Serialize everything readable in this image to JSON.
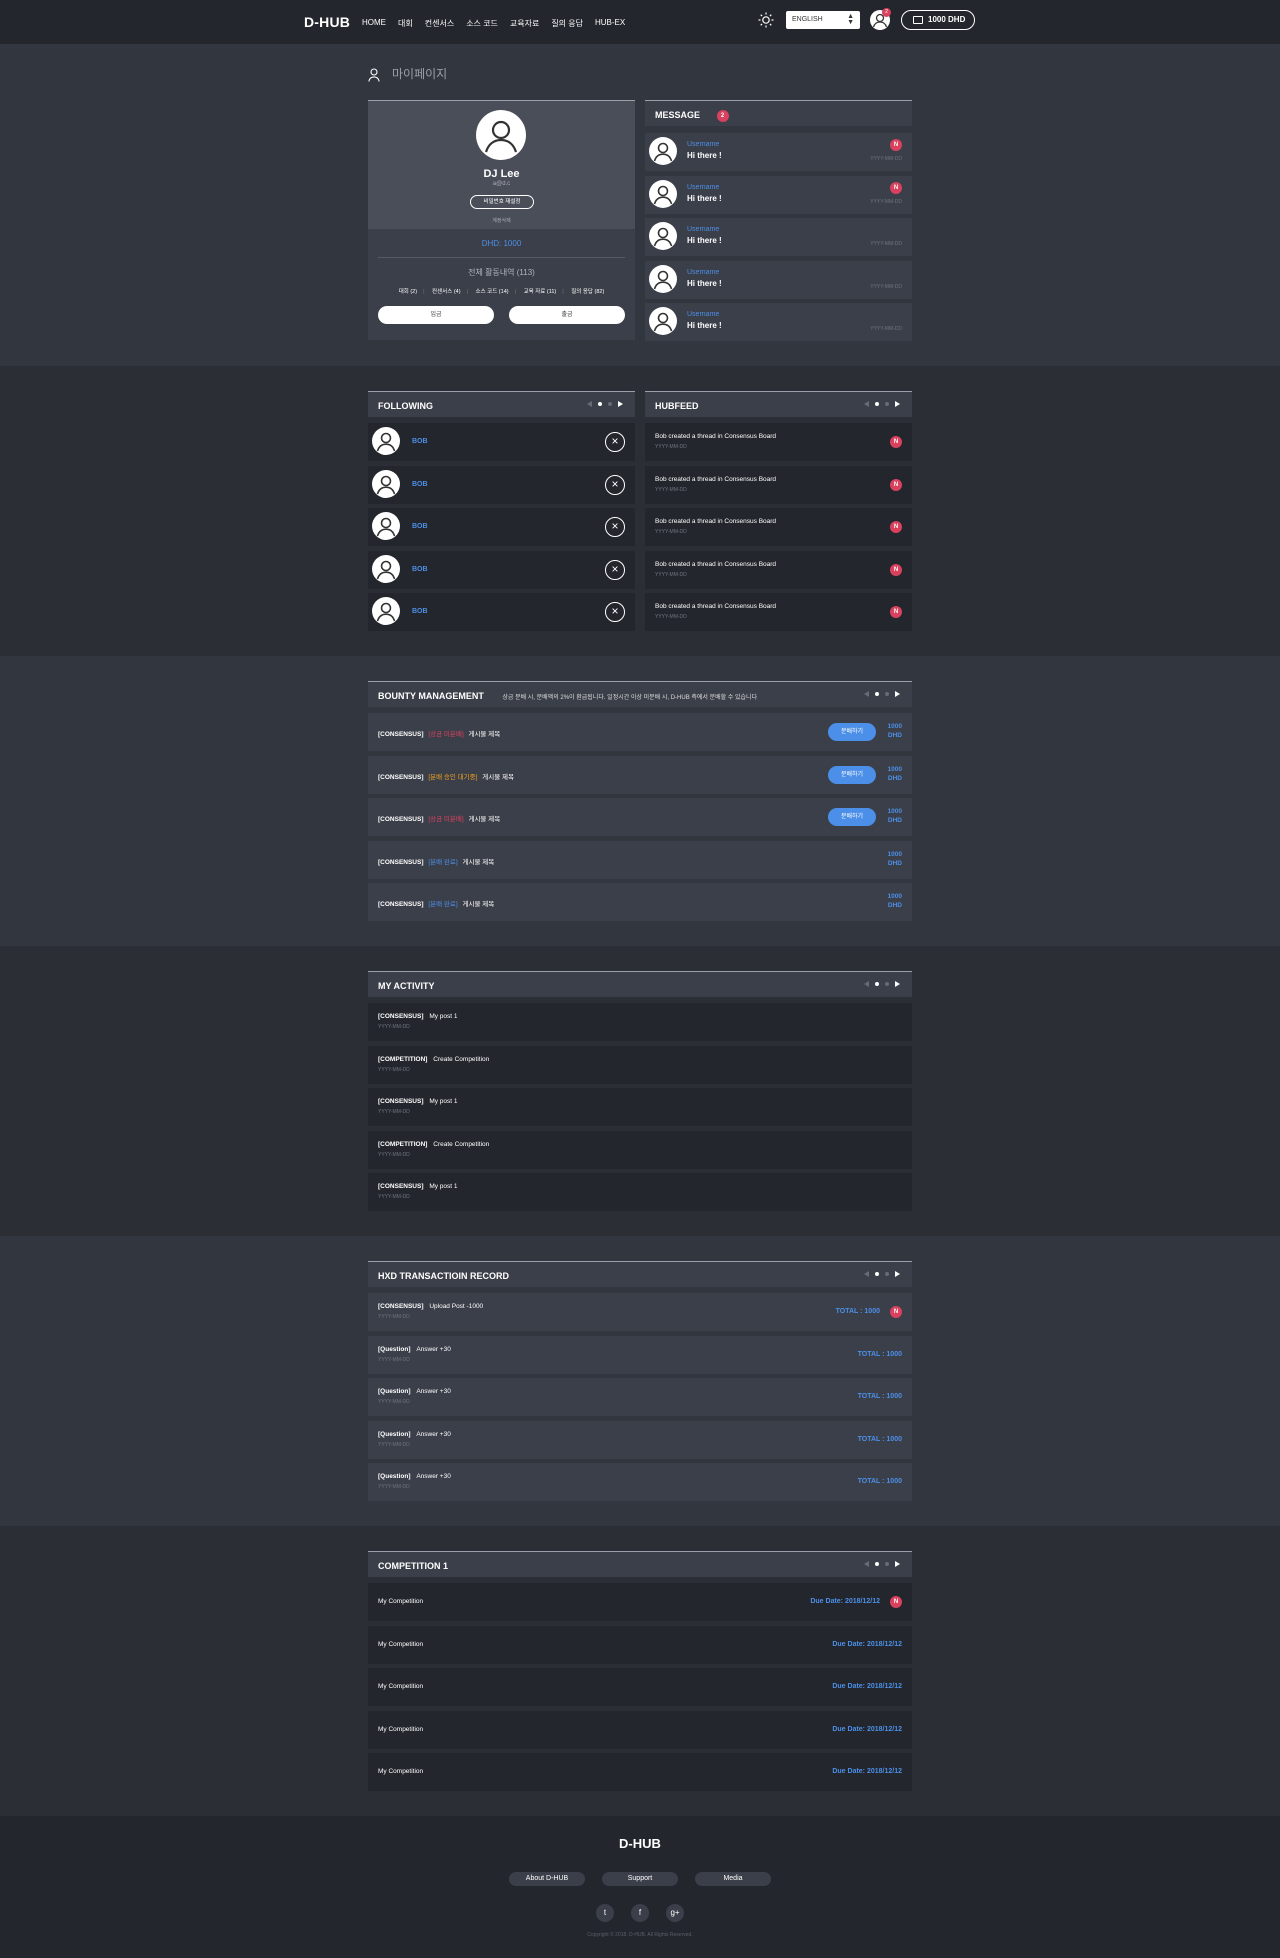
{
  "header": {
    "logo": "D-HUB",
    "nav": [
      "HOME",
      "대회",
      "컨센서스",
      "소스 코드",
      "교육자료",
      "질의 응답",
      "HUB-EX"
    ],
    "language": "ENGLISH",
    "notification_count": "2",
    "wallet": "1000 DHD"
  },
  "page_title": "마이페이지",
  "profile": {
    "name": "DJ Lee",
    "id": "a@d.c",
    "reset_password": "비밀번호 재설정",
    "delete_account": "계정삭제",
    "dhd": "DHD: 1000",
    "activity_total": "전체 활동내역 (113)",
    "categories": [
      "대회 (2)",
      "컨센서스 (4)",
      "소스 코드 (14)",
      "교육 자료 (11)",
      "질의 응답 (82)"
    ],
    "deposit": "입금",
    "withdraw": "출금"
  },
  "message": {
    "title": "MESSAGE",
    "count": "2",
    "items": [
      {
        "user": "Username",
        "text": "Hi there !",
        "date": "YYYY-MM-DD",
        "new": "N"
      },
      {
        "user": "Username",
        "text": "Hi there !",
        "date": "YYYY-MM-DD",
        "new": "N"
      },
      {
        "user": "Username",
        "text": "Hi there !",
        "date": "YYYY-MM-DD",
        "new": ""
      },
      {
        "user": "Username",
        "text": "Hi there !",
        "date": "YYYY-MM-DD",
        "new": ""
      },
      {
        "user": "Username",
        "text": "Hi there !",
        "date": "YYYY-MM-DD",
        "new": ""
      }
    ]
  },
  "following": {
    "title": "FOLLOWING",
    "items": [
      "BOB",
      "BOB",
      "BOB",
      "BOB",
      "BOB"
    ]
  },
  "hubfeed": {
    "title": "HUBFEED",
    "items": [
      {
        "text": "Bob created a thread in Consensus Board",
        "date": "YYYY-MM-DD",
        "new": "N"
      },
      {
        "text": "Bob created a thread in Consensus Board",
        "date": "YYYY-MM-DD",
        "new": "N"
      },
      {
        "text": "Bob created a thread in Consensus Board",
        "date": "YYYY-MM-DD",
        "new": "N"
      },
      {
        "text": "Bob created a thread in Consensus Board",
        "date": "YYYY-MM-DD",
        "new": "N"
      },
      {
        "text": "Bob created a thread in Consensus Board",
        "date": "YYYY-MM-DD",
        "new": "N"
      }
    ]
  },
  "bounty": {
    "title": "BOUNTY MANAGEMENT",
    "notice": "상금 분배 시, 분배액의 2%이 환급됩니다. 일정시간 이상 미분배 시, D-HUB 측에서 분배할 수 있습니다",
    "sell": "분배하기",
    "amount1": "1000",
    "amount2": "DHD",
    "items": [
      {
        "cat": "[CONSENSUS]",
        "status": "[상금 미분배]",
        "color": "#d9415e",
        "title": "게시물 제목",
        "btn": true
      },
      {
        "cat": "[CONSENSUS]",
        "status": "[분배 승인 대기중]",
        "color": "#f0a020",
        "title": "게시물 제목",
        "btn": true
      },
      {
        "cat": "[CONSENSUS]",
        "status": "[상금 미분배]",
        "color": "#d9415e",
        "title": "게시물 제목",
        "btn": true
      },
      {
        "cat": "[CONSENSUS]",
        "status": "[분배 완료]",
        "color": "#4c8fe8",
        "title": "게시물 제목",
        "btn": false
      },
      {
        "cat": "[CONSENSUS]",
        "status": "[분배 완료]",
        "color": "#4c8fe8",
        "title": "게시물 제목",
        "btn": false
      }
    ]
  },
  "activity": {
    "title": "MY ACTIVITY",
    "items": [
      {
        "cat": "[CONSENSUS]",
        "text": "My post 1",
        "date": "YYYY-MM-DD"
      },
      {
        "cat": "[COMPETITION]",
        "text": "Create Competition",
        "date": "YYYY-MM-DD"
      },
      {
        "cat": "[CONSENSUS]",
        "text": "My post 1",
        "date": "YYYY-MM-DD"
      },
      {
        "cat": "[COMPETITION]",
        "text": "Create Competition",
        "date": "YYYY-MM-DD"
      },
      {
        "cat": "[CONSENSUS]",
        "text": "My post 1",
        "date": "YYYY-MM-DD"
      }
    ]
  },
  "transactions": {
    "title": "HXD TRANSACTIOIN RECORD",
    "items": [
      {
        "cat": "[CONSENSUS]",
        "text": "Upload Post -1000",
        "date": "YYYY-MM-DD",
        "total": "TOTAL : 1000",
        "new": "N"
      },
      {
        "cat": "[Question]",
        "text": "Answer +30",
        "date": "YYYY-MM-DD",
        "total": "TOTAL : 1000",
        "new": ""
      },
      {
        "cat": "[Question]",
        "text": "Answer +30",
        "date": "YYYY-MM-DD",
        "total": "TOTAL : 1000",
        "new": ""
      },
      {
        "cat": "[Question]",
        "text": "Answer +30",
        "date": "YYYY-MM-DD",
        "total": "TOTAL : 1000",
        "new": ""
      },
      {
        "cat": "[Question]",
        "text": "Answer +30",
        "date": "YYYY-MM-DD",
        "total": "TOTAL : 1000",
        "new": ""
      }
    ]
  },
  "competition": {
    "title": "COMPETITION 1",
    "items": [
      {
        "text": "My Competition",
        "due": "Due Date: 2018/12/12",
        "new": "N"
      },
      {
        "text": "My Competition",
        "due": "Due Date: 2018/12/12",
        "new": ""
      },
      {
        "text": "My Competition",
        "due": "Due Date: 2018/12/12",
        "new": ""
      },
      {
        "text": "My Competition",
        "due": "Due Date: 2018/12/12",
        "new": ""
      },
      {
        "text": "My Competition",
        "due": "Due Date: 2018/12/12",
        "new": ""
      }
    ]
  },
  "footer": {
    "logo": "D-HUB",
    "links": [
      "About D-HUB",
      "Support",
      "Media"
    ],
    "social": [
      "twitter-icon",
      "facebook-icon",
      "google-plus-icon"
    ],
    "copyright": "Copyright © 2018. D-HUB. All Rights Reserved."
  },
  "colors": {
    "accent": "#4c8fe8",
    "badge": "#d9415e",
    "pending": "#f0a020"
  }
}
